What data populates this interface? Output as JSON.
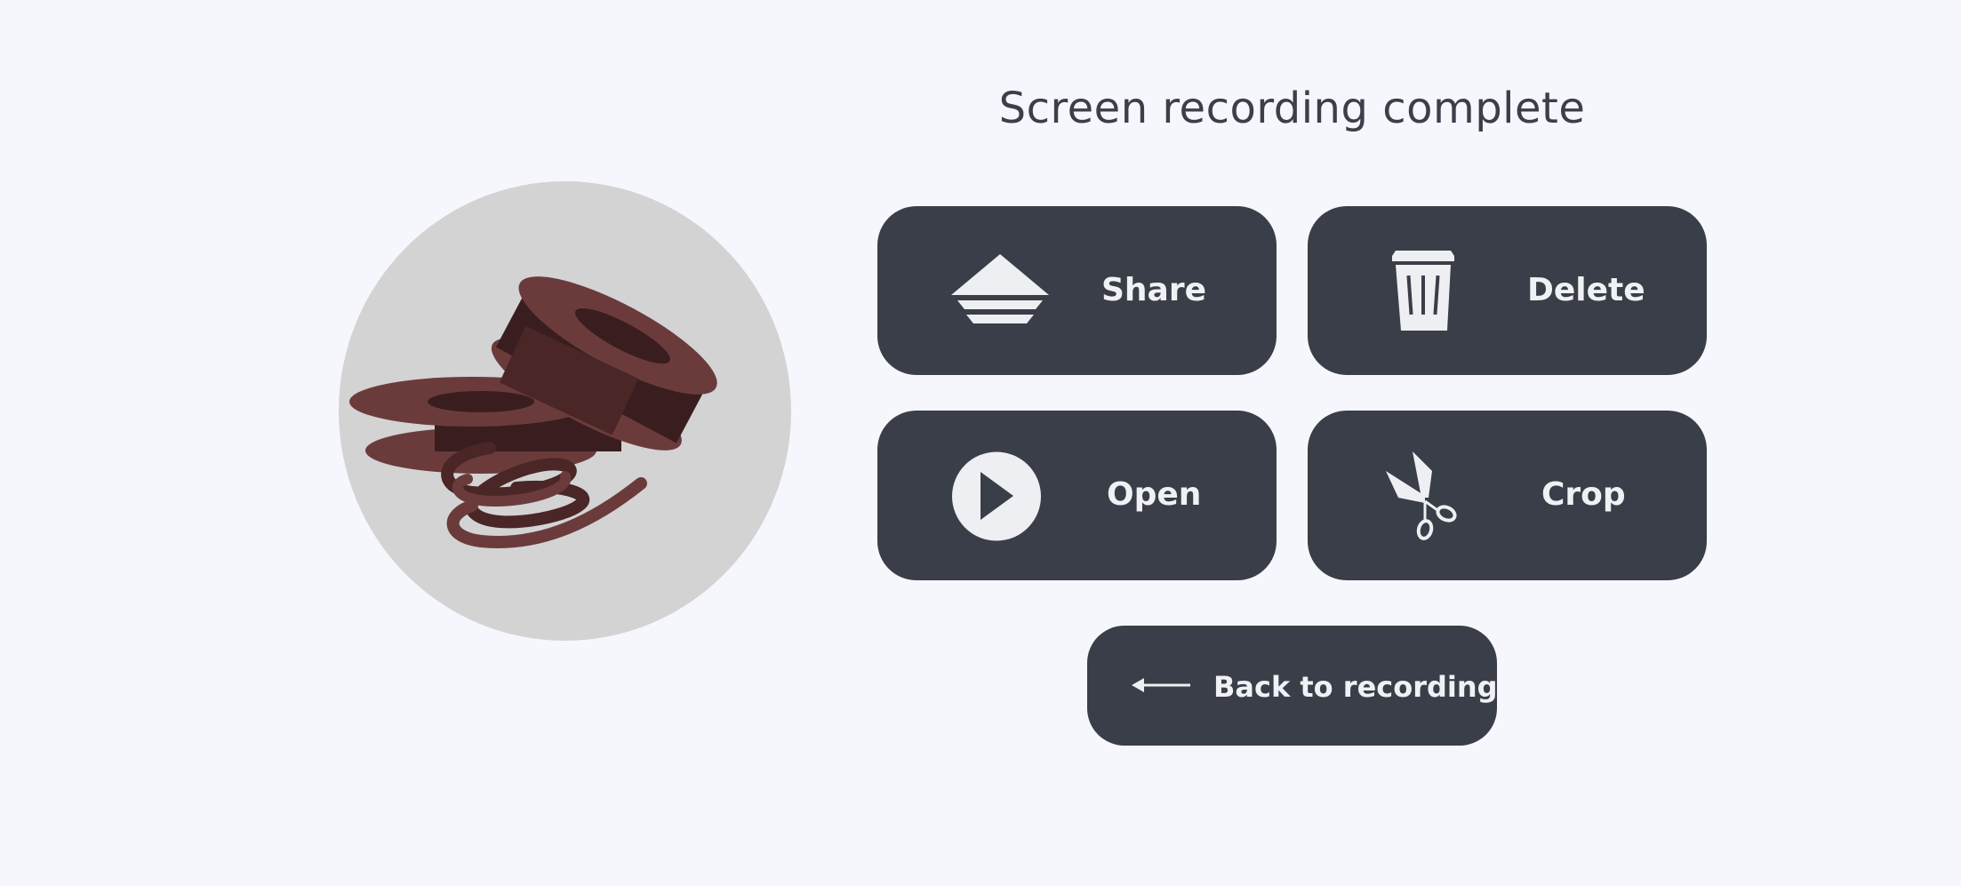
{
  "screen": {
    "title": "Screen recording complete"
  },
  "illustration": {
    "name": "film-reels-illustration",
    "background_color": "#d3d3d4",
    "reel_color": "#6b3b3b",
    "reel_dark_color": "#3a1e1f"
  },
  "actions": {
    "share": {
      "label": "Share",
      "icon": "share-icon"
    },
    "delete": {
      "label": "Delete",
      "icon": "trash-icon"
    },
    "open": {
      "label": "Open",
      "icon": "play-icon"
    },
    "crop": {
      "label": "Crop",
      "icon": "scissors-icon"
    }
  },
  "back": {
    "label": "Back to recording",
    "icon": "arrow-left-icon"
  },
  "colors": {
    "page_background": "#f6f7fc",
    "button_background": "#393e48",
    "button_text": "#f0f1f4",
    "title_text": "#3a3f4a"
  }
}
